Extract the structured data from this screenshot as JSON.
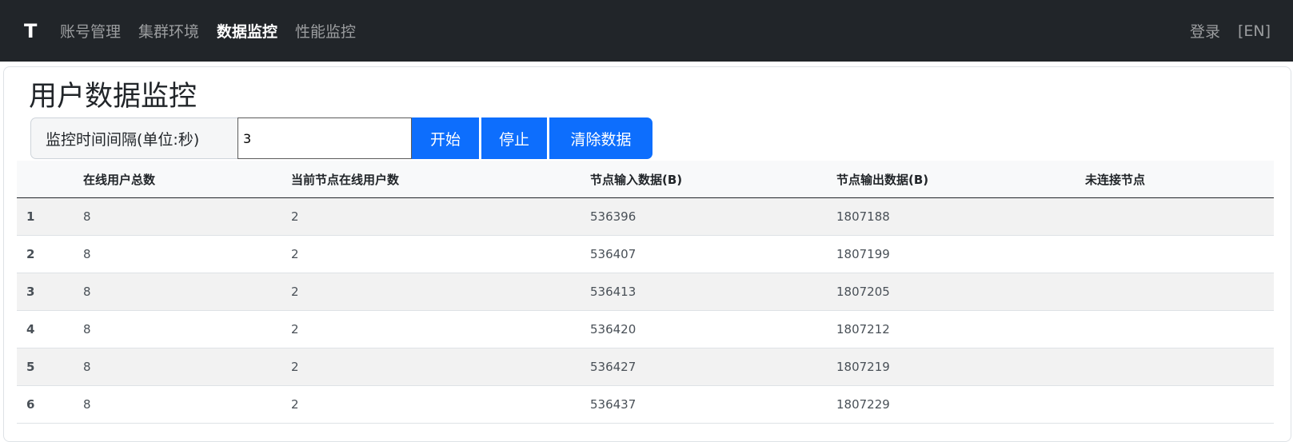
{
  "navbar": {
    "brand": "T",
    "items": [
      {
        "label": "账号管理",
        "active": false
      },
      {
        "label": "集群环境",
        "active": false
      },
      {
        "label": "数据监控",
        "active": true
      },
      {
        "label": "性能监控",
        "active": false
      }
    ],
    "login": "登录",
    "lang": "[EN]"
  },
  "page": {
    "title": "用户数据监控"
  },
  "controls": {
    "interval_label": "监控时间间隔(单位:秒)",
    "interval_value": "3",
    "start": "开始",
    "stop": "停止",
    "clear": "清除数据"
  },
  "table": {
    "headers": [
      "",
      "在线用户总数",
      "当前节点在线用户数",
      "节点输入数据(B)",
      "节点输出数据(B)",
      "未连接节点"
    ],
    "rows": [
      [
        "1",
        "8",
        "2",
        "536396",
        "1807188",
        ""
      ],
      [
        "2",
        "8",
        "2",
        "536407",
        "1807199",
        ""
      ],
      [
        "3",
        "8",
        "2",
        "536413",
        "1807205",
        ""
      ],
      [
        "4",
        "8",
        "2",
        "536420",
        "1807212",
        ""
      ],
      [
        "5",
        "8",
        "2",
        "536427",
        "1807219",
        ""
      ],
      [
        "6",
        "8",
        "2",
        "536437",
        "1807229",
        ""
      ]
    ]
  },
  "colors": {
    "navbar": "#212529",
    "primary": "#0d6efd",
    "stripe": "#f2f2f2"
  }
}
